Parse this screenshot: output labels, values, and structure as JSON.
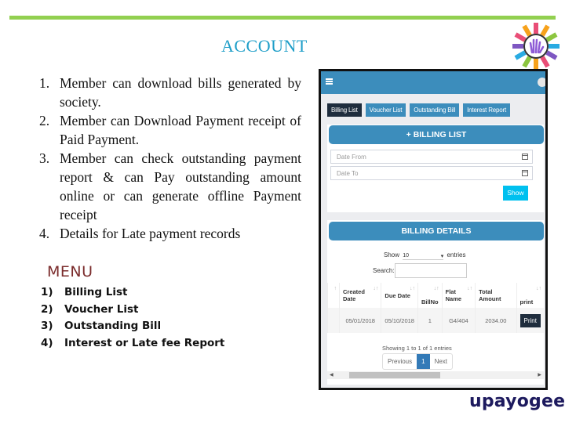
{
  "slide": {
    "title": "ACCOUNT",
    "features": [
      {
        "num": "1.",
        "text": "Member can download bills generated by society."
      },
      {
        "num": "2.",
        "text": "Member can Download Payment receipt of Paid Payment."
      },
      {
        "num": "3.",
        "text": "Member can check outstanding payment report & can Pay outstanding amount online or can generate offline Payment receipt"
      },
      {
        "num": "4.",
        "text": "Details for Late payment records"
      }
    ],
    "menu_title": "MENU",
    "menu_items": [
      {
        "num": "1)",
        "text": "Billing List"
      },
      {
        "num": "2)",
        "text": "Voucher List"
      },
      {
        "num": "3)",
        "text": "Outstanding Bill"
      },
      {
        "num": "4)",
        "text": "Interest or Late fee Report"
      }
    ],
    "brand": "upayogee",
    "colors": {
      "accent_bar": "#92d050",
      "title": "#1e9ec8",
      "menu_title": "#7b2c2c",
      "app_primary": "#3c8dbc"
    }
  },
  "app": {
    "tabs": [
      {
        "label": "Billing List",
        "active": true
      },
      {
        "label": "Voucher List",
        "active": false
      },
      {
        "label": "Outstanding Bill",
        "active": false
      },
      {
        "label": "Interest Report",
        "active": false
      }
    ],
    "billing_list_header": "+ BILLING LIST",
    "date_from_placeholder": "Date From",
    "date_to_placeholder": "Date To",
    "show_button": "Show",
    "billing_details_header": "BILLING DETAILS",
    "length_label_pre": "Show",
    "length_value": "10",
    "length_label_post": "entries",
    "search_label": "Search:",
    "columns": [
      "",
      "Created Date",
      "Due Date",
      "BillNo",
      "Flat Name",
      "Total Amount",
      "print"
    ],
    "rows": [
      {
        "created": "05/01/2018",
        "due": "05/10/2018",
        "billno": "1",
        "flat": "G4/404",
        "amount": "2034.00",
        "print_label": "Print"
      }
    ],
    "info": "Showing 1 to 1 of 1 entries",
    "pager": {
      "prev": "Previous",
      "current": "1",
      "next": "Next"
    }
  }
}
